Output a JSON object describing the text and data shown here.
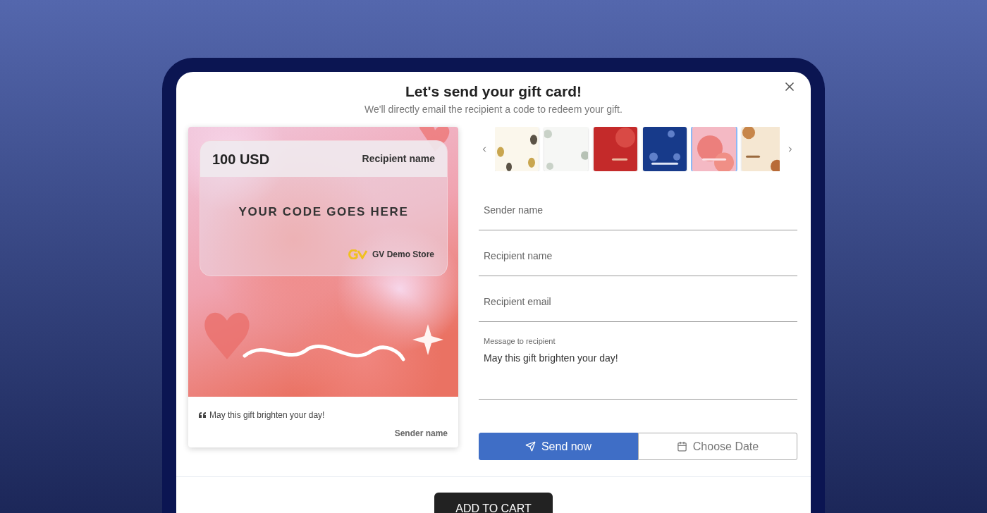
{
  "dialog": {
    "title": "Let's send your gift card!",
    "subtitle": "We'll directly email the recipient a code to redeem your gift."
  },
  "preview": {
    "amount": "100 USD",
    "recipient": "Recipient name",
    "code": "YOUR CODE GOES HERE",
    "store": "GV Demo Store",
    "message": "May this gift brighten your day!",
    "sender": "Sender name"
  },
  "templates": [
    {
      "kind": "balloons",
      "selected": false
    },
    {
      "kind": "leaves",
      "selected": false
    },
    {
      "kind": "christmas",
      "selected": false
    },
    {
      "kind": "fireworks",
      "selected": false
    },
    {
      "kind": "valentine",
      "selected": true
    },
    {
      "kind": "autumn",
      "selected": false
    }
  ],
  "fields": [
    {
      "placeholder": "Sender name"
    },
    {
      "placeholder": "Recipient name"
    },
    {
      "placeholder": "Recipient email"
    }
  ],
  "message": {
    "label": "Message to recipient",
    "value": "May this gift brighten your day!"
  },
  "delivery": [
    {
      "kind": "send",
      "label": "Send now",
      "selected": true
    },
    {
      "kind": "date",
      "label": "Choose Date",
      "selected": false
    }
  ],
  "cart_button": "ADD TO CART"
}
